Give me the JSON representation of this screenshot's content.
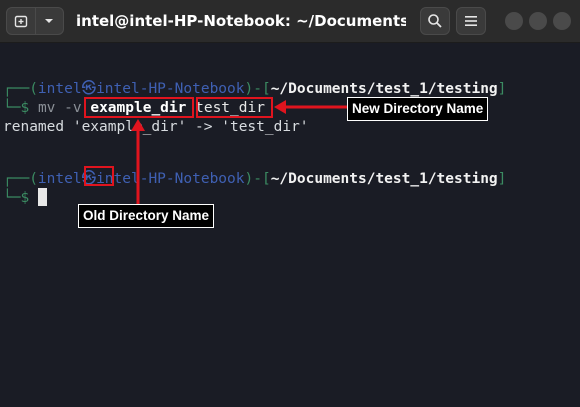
{
  "window": {
    "title": "intel@intel-HP-Notebook: ~/Documents/te...",
    "colors": {
      "titlebar": "#2b2b2b",
      "terminal_bg": "#1a1c25",
      "prompt_green": "#3b8b62",
      "prompt_blue": "#3f60b3",
      "annotation_red": "#e0141e"
    }
  },
  "terminal": {
    "prompt1": {
      "open": "┌──(",
      "user": "intel",
      "host": "intel-HP-Notebook",
      "mid": ")-[",
      "path": "~/Documents/test_1/testing",
      "close": "]",
      "arrow": "└─$",
      "command": "mv",
      "flag": "-v",
      "arg_old": "example_dir",
      "arg_new": "test_dir"
    },
    "output": "renamed 'example_dir' -> 'test_dir'",
    "prompt2": {
      "open": "┌──(",
      "user": "intel",
      "host": "intel-HP-Notebook",
      "mid": ")-[",
      "path": "~/Documents/test_1/testing",
      "close": "]",
      "arrow": "└─$"
    }
  },
  "annotations": {
    "new_name": "New Directory Name",
    "old_name": "Old Directory Name"
  }
}
